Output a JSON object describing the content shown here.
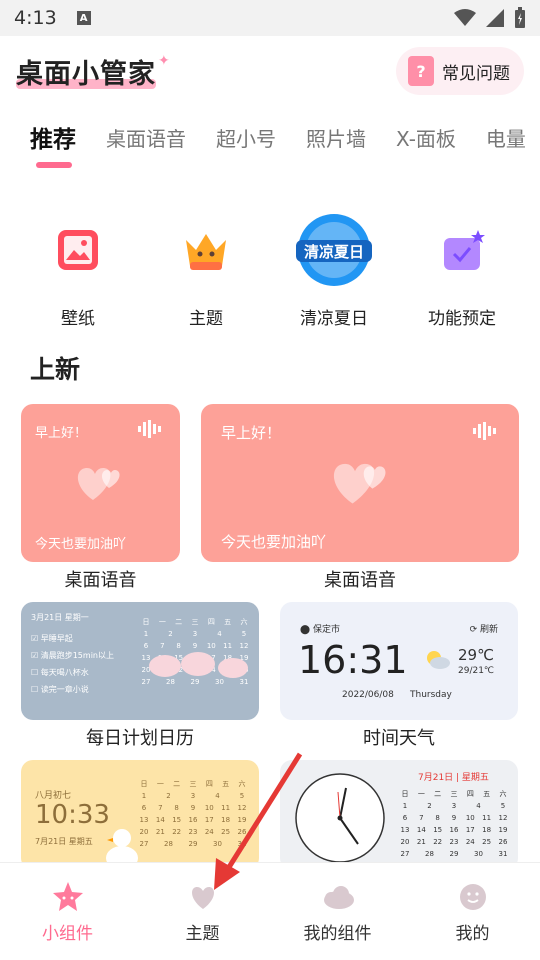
{
  "status": {
    "time": "4:13",
    "a_icon": "A"
  },
  "header": {
    "logo": "桌面小管家",
    "faq_label": "常见问题",
    "faq_icon_glyph": "?"
  },
  "tabs": [
    {
      "label": "推荐",
      "active": true
    },
    {
      "label": "桌面语音"
    },
    {
      "label": "超小号"
    },
    {
      "label": "照片墙"
    },
    {
      "label": "X-面板"
    },
    {
      "label": "电量"
    }
  ],
  "quick": [
    {
      "label": "壁纸",
      "icon": "wallpaper-icon"
    },
    {
      "label": "主题",
      "icon": "crown-icon"
    },
    {
      "label": "清凉夏日",
      "icon": "summer-badge-icon",
      "badge_text": "清凉夏日"
    },
    {
      "label": "功能预定",
      "icon": "thumbs-up-icon"
    }
  ],
  "section": {
    "new_title": "上新"
  },
  "cards": {
    "voice1": {
      "greet": "早上好！",
      "sub": "今天也要加油吖",
      "label": "桌面语音"
    },
    "voice2": {
      "greet": "早上好！",
      "sub": "今天也要加油吖",
      "label": "桌面语音"
    },
    "calendar": {
      "label": "每日计划日历",
      "date_text": "3月21日 星期一",
      "tasks": [
        "早睡早起",
        "清晨跑步15min以上",
        "每天喝八杯水",
        "读完一章小说"
      ],
      "weekdays": [
        "日",
        "一",
        "二",
        "三",
        "四",
        "五",
        "六"
      ],
      "rows": [
        [
          "1",
          "2",
          "3",
          "4",
          "5"
        ],
        [
          "6",
          "7",
          "8",
          "9",
          "10",
          "11",
          "12"
        ],
        [
          "13",
          "14",
          "15",
          "16",
          "17",
          "18",
          "19"
        ],
        [
          "20",
          "21",
          "22",
          "23",
          "24",
          "25",
          "26"
        ],
        [
          "27",
          "28",
          "29",
          "30",
          "31"
        ]
      ]
    },
    "weather": {
      "label": "时间天气",
      "city": "保定市",
      "refresh": "刷新",
      "time": "16:31",
      "temp": "29℃",
      "range": "29/21℃",
      "date": "2022/06/08",
      "weekday": "Thursday"
    },
    "clock10": {
      "date_top": "八月初七",
      "time": "10:33",
      "date_bottom": "7月21日 星期五",
      "weekdays": [
        "日",
        "一",
        "二",
        "三",
        "四",
        "五",
        "六"
      ]
    },
    "clockcal": {
      "header": "7月21日 | 星期五",
      "weekdays": [
        "日",
        "一",
        "二",
        "三",
        "四",
        "五",
        "六"
      ]
    }
  },
  "nav": [
    {
      "label": "小组件",
      "icon": "star-icon",
      "active": true
    },
    {
      "label": "主题",
      "icon": "heart-icon"
    },
    {
      "label": "我的组件",
      "icon": "cloud-icon"
    },
    {
      "label": "我的",
      "icon": "smiley-icon"
    }
  ],
  "colors": {
    "accent": "#ff6a8f",
    "voice_card": "#fda198",
    "calendar_card": "#a9b9c9",
    "arrow": "#e53935"
  }
}
